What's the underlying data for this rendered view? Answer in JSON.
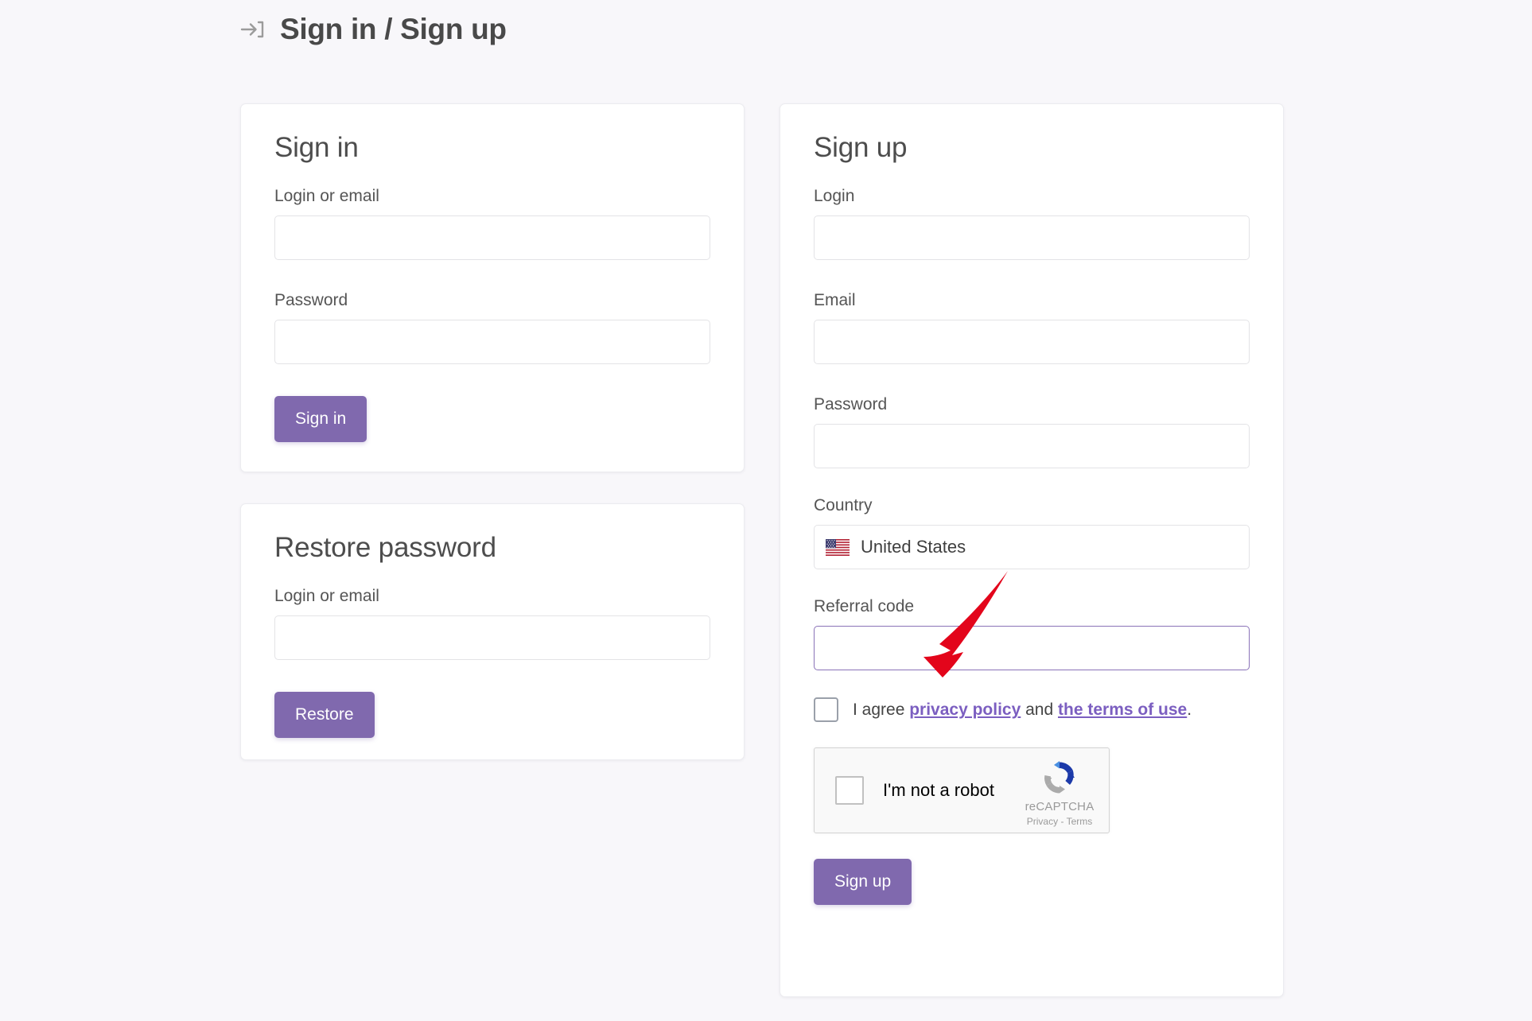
{
  "header": {
    "icon": "login-arrow-icon",
    "title": "Sign in / Sign up"
  },
  "signin_card": {
    "title": "Sign in",
    "fields": [
      {
        "label": "Login or email",
        "value": "",
        "placeholder": "",
        "type": "text"
      },
      {
        "label": "Password",
        "value": "",
        "placeholder": "",
        "type": "password"
      }
    ],
    "submit_label": "Sign in"
  },
  "restore_card": {
    "title": "Restore password",
    "fields": [
      {
        "label": "Login or email",
        "value": "",
        "placeholder": "",
        "type": "text"
      }
    ],
    "submit_label": "Restore"
  },
  "signup_card": {
    "title": "Sign up",
    "fields": [
      {
        "label": "Login",
        "value": "",
        "placeholder": "",
        "type": "text"
      },
      {
        "label": "Email",
        "value": "",
        "placeholder": "",
        "type": "text"
      },
      {
        "label": "Password",
        "value": "",
        "placeholder": "",
        "type": "password"
      }
    ],
    "country": {
      "label": "Country",
      "selected": "United States",
      "flag": "us-flag-icon"
    },
    "referral": {
      "label": "Referral code",
      "value": "",
      "placeholder": "",
      "focused": true
    },
    "agreement": {
      "checked": false,
      "prefix": "I agree ",
      "link1": "privacy policy",
      "middle": " and ",
      "link2": "the terms of use",
      "suffix": "."
    },
    "recaptcha": {
      "checked": false,
      "label": "I'm not a robot",
      "brand": "reCAPTCHA",
      "privacy": "Privacy",
      "separator": " - ",
      "terms": "Terms"
    },
    "submit_label": "Sign up"
  },
  "annotation": {
    "type": "arrow",
    "color": "#e3051b",
    "points_to": "referral-code-input"
  },
  "colors": {
    "page_background": "#f8f7fa",
    "card_background": "#ffffff",
    "accent_purple": "#8069ae",
    "link_purple": "#7b5ec0",
    "focus_border": "#8a72b8",
    "input_border": "#e3e3e6",
    "annotation_red": "#e3051b"
  }
}
